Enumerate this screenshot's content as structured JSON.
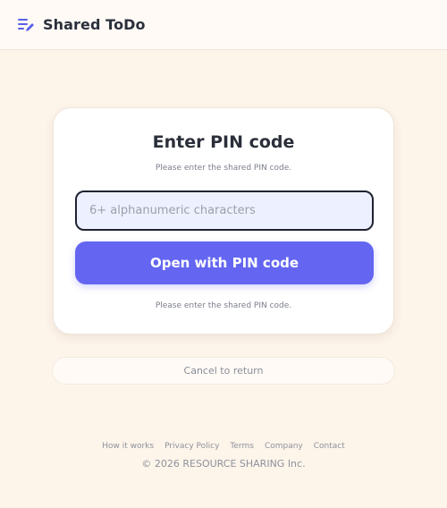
{
  "header": {
    "app_title": "Shared ToDo",
    "logo_icon": "list-edit-icon"
  },
  "card": {
    "title": "Enter PIN code",
    "subtitle": "Please enter the shared PIN code.",
    "pin_input": {
      "value": "",
      "placeholder": "6+ alphanumeric characters"
    },
    "submit_label": "Open with PIN code",
    "hint": "Please enter the shared PIN code."
  },
  "cancel_label": "Cancel to return",
  "footer": {
    "links": [
      "How it works",
      "Privacy Policy",
      "Terms",
      "Company",
      "Contact"
    ],
    "copyright": "© 2026 RESOURCE SHARING Inc."
  },
  "colors": {
    "accent": "#6466f1",
    "background": "#fdf4ea",
    "input_bg": "#edf1ff"
  }
}
